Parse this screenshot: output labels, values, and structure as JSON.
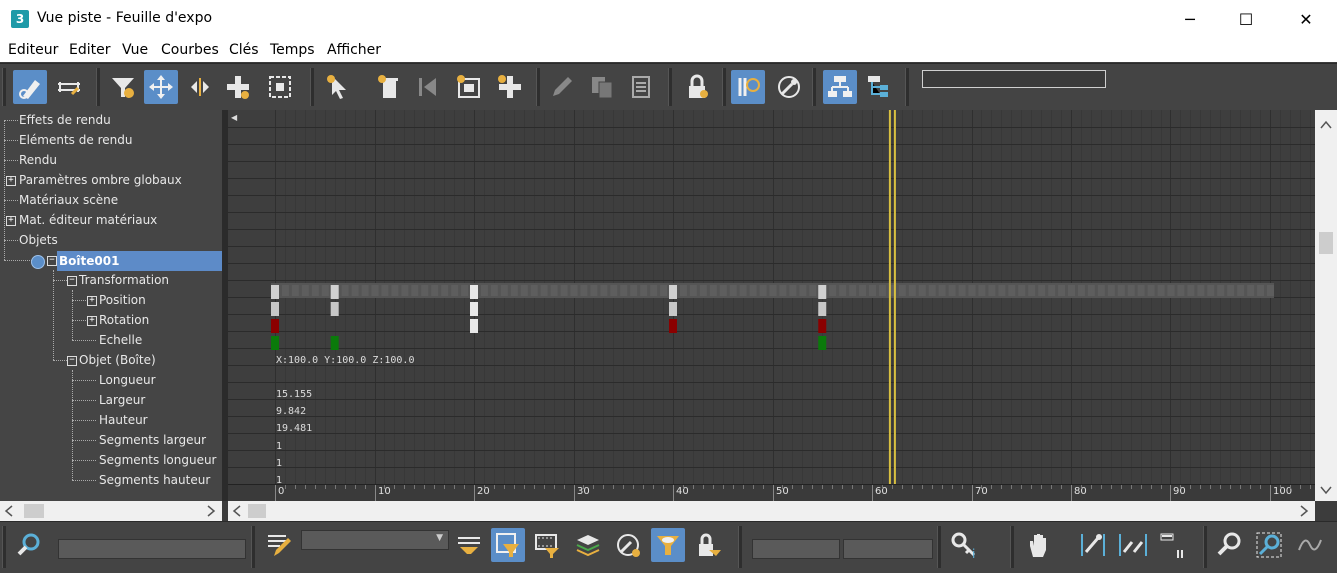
{
  "window": {
    "title": "Vue piste - Feuille d'expo",
    "app_icon_label": "3",
    "minimize_glyph": "─",
    "maximize_glyph": "☐",
    "close_glyph": "✕"
  },
  "menu": [
    "Editeur",
    "Editer",
    "Vue",
    "Courbes",
    "Clés",
    "Temps",
    "Afficher"
  ],
  "toolbar_icons": [
    "filter-keys-icon",
    "snap-frames-icon",
    "filter-icon",
    "move-keys-icon",
    "slide-keys-icon",
    "add-keys-icon",
    "scale-keys-icon",
    "select-pointer-icon",
    "delete-key-icon",
    "first-key-icon",
    "region-icon",
    "add-key-icon",
    "pencil-icon",
    "copy-icon",
    "paste-icon",
    "lock-icon",
    "edit-ranges-icon",
    "show-key-icon",
    "hierarchy-icon",
    "child-tree-icon"
  ],
  "tree": {
    "items": [
      {
        "label": "Effets de rendu"
      },
      {
        "label": "Eléments de rendu"
      },
      {
        "label": "Rendu"
      },
      {
        "label": "Paramètres ombre globaux"
      },
      {
        "label": "Matériaux scène"
      },
      {
        "label": "Mat. éditeur matériaux"
      },
      {
        "label": "Objets"
      },
      {
        "label": "Boîte001"
      },
      {
        "label": "Transformation"
      },
      {
        "label": "Position"
      },
      {
        "label": "Rotation"
      },
      {
        "label": "Echelle"
      },
      {
        "label": "Objet (Boîte)"
      },
      {
        "label": "Longueur"
      },
      {
        "label": "Largeur"
      },
      {
        "label": "Hauteur"
      },
      {
        "label": "Segments largeur"
      },
      {
        "label": "Segments longueur"
      },
      {
        "label": "Segments hauteur"
      }
    ],
    "expander_glyph_plus": "+",
    "expander_glyph_minus": "−"
  },
  "track": {
    "scale_text": "X:100.0 Y:100.0 Z:100.0",
    "values": [
      "15.155",
      "9.842",
      "19.481",
      "1",
      "1",
      "1"
    ],
    "ruler_labels": [
      "0",
      "10",
      "20",
      "30",
      "40",
      "50",
      "60",
      "70",
      "80",
      "90",
      "100"
    ],
    "collapse_glyph": "◀",
    "current_frame": 62
  },
  "bottom_icons": [
    "zoom-icon",
    "edit-track-icon",
    "filter-selected-icon",
    "filter-animated-icon",
    "filter-layers-icon",
    "filter-visible-icon",
    "filter-controllers-icon",
    "lock-selection-icon",
    "key-info-icon",
    "pan-icon",
    "frame-horizontal-icon",
    "frame-value-icon",
    "frame-range-icon",
    "zoom-icon-2",
    "zoom-region-icon",
    "isolate-curve-icon"
  ],
  "colors": {
    "accent": "#5b8ec8",
    "key_white": "#e8e8e8",
    "key_red": "#8b0000",
    "key_green": "#0a7a0a",
    "time_slider": "#d8c040"
  }
}
